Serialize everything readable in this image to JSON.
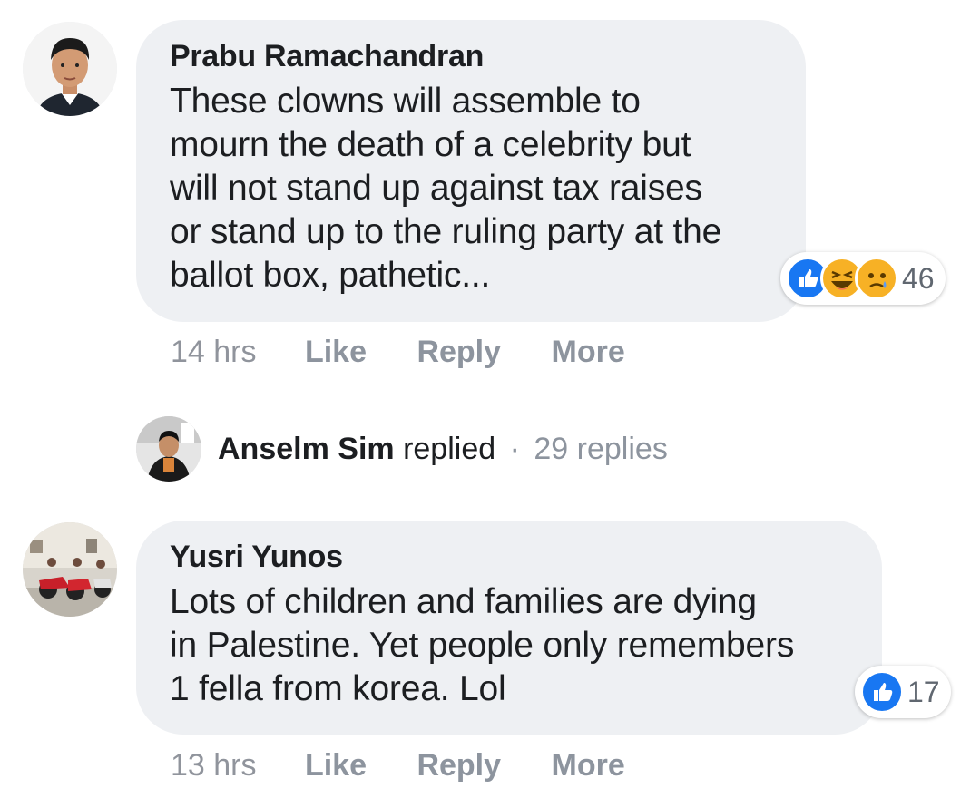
{
  "comments": [
    {
      "author": "Prabu Ramachandran",
      "lines": [
        "These clowns will assemble to",
        "mourn the death of a celebrity but",
        "will not stand up against tax raises",
        "or stand up to the ruling party at the",
        "ballot box, pathetic..."
      ],
      "reaction_count": "46",
      "reactions": [
        "like",
        "haha",
        "sad"
      ],
      "time": "14 hrs",
      "like_label": "Like",
      "reply_label": "Reply",
      "more_label": "More"
    },
    {
      "author": "Yusri Yunos",
      "lines": [
        "Lots of children and families are dying",
        "in Palestine. Yet people only remembers",
        "1 fella from korea. Lol"
      ],
      "reaction_count": "17",
      "reactions": [
        "like"
      ],
      "time": "13 hrs",
      "like_label": "Like",
      "reply_label": "Reply",
      "more_label": "More"
    }
  ],
  "reply_summary": {
    "name": "Anselm Sim",
    "verb": "replied",
    "separator": "·",
    "count_text": "29 replies"
  },
  "colors": {
    "bubble": "#eef0f3",
    "like_blue": "#1877f2",
    "emoji_yellow": "#f7b125",
    "muted_text": "#8d949e"
  }
}
